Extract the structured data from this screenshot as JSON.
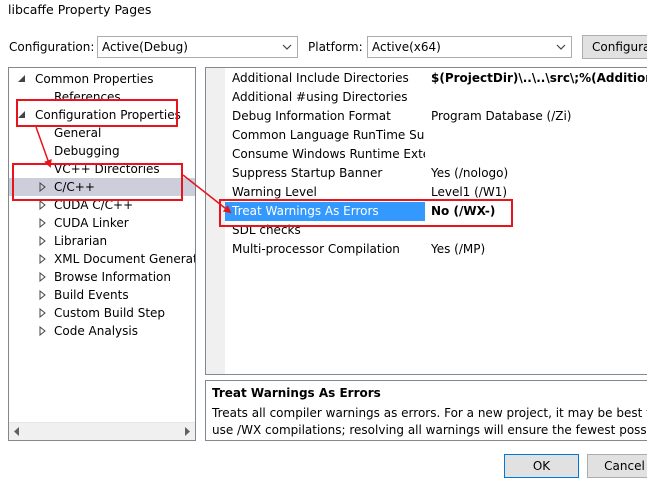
{
  "window": {
    "title": "libcaffe Property Pages"
  },
  "toolbar": {
    "configuration_label": "Configuration:",
    "configuration_value": "Active(Debug)",
    "platform_label": "Platform:",
    "platform_value": "Active(x64)",
    "config_manager_label": "Configura"
  },
  "tree": {
    "items": [
      {
        "label": "Common Properties",
        "expanded": true
      },
      {
        "label": "References"
      },
      {
        "label": "Configuration Properties",
        "expanded": true
      },
      {
        "label": "General"
      },
      {
        "label": "Debugging"
      },
      {
        "label": "VC++ Directories"
      },
      {
        "label": "C/C++",
        "selected": true
      },
      {
        "label": "CUDA C/C++"
      },
      {
        "label": "CUDA Linker"
      },
      {
        "label": "Librarian"
      },
      {
        "label": "XML Document Generator"
      },
      {
        "label": "Browse Information"
      },
      {
        "label": "Build Events"
      },
      {
        "label": "Custom Build Step"
      },
      {
        "label": "Code Analysis"
      }
    ]
  },
  "grid": {
    "rows": [
      {
        "name": "Additional Include Directories",
        "value": "$(ProjectDir)\\..\\..\\src\\;%(AdditionalInclu",
        "bold": true
      },
      {
        "name": "Additional #using Directories",
        "value": ""
      },
      {
        "name": "Debug Information Format",
        "value": "Program Database (/Zi)"
      },
      {
        "name": "Common Language RunTime Suppo",
        "value": ""
      },
      {
        "name": "Consume Windows Runtime Extensic",
        "value": ""
      },
      {
        "name": "Suppress Startup Banner",
        "value": "Yes (/nologo)"
      },
      {
        "name": "Warning Level",
        "value": "Level1 (/W1)"
      },
      {
        "name": "Treat Warnings As Errors",
        "value": "No (/WX-)",
        "bold": true,
        "selected": true
      },
      {
        "name": "SDL checks",
        "value": ""
      },
      {
        "name": "Multi-processor Compilation",
        "value": "Yes (/MP)"
      }
    ]
  },
  "description": {
    "title": "Treat Warnings As Errors",
    "text": "Treats all compiler warnings as errors. For a new project, it may be best to use /WX compilations; resolving all warnings will ensure the fewest possible hard-to-find co"
  },
  "buttons": {
    "ok": "OK",
    "cancel": "Cancel"
  },
  "colors": {
    "annotation": "#e8141c",
    "selection": "#3399ff",
    "tree_selection": "#cccedb"
  }
}
